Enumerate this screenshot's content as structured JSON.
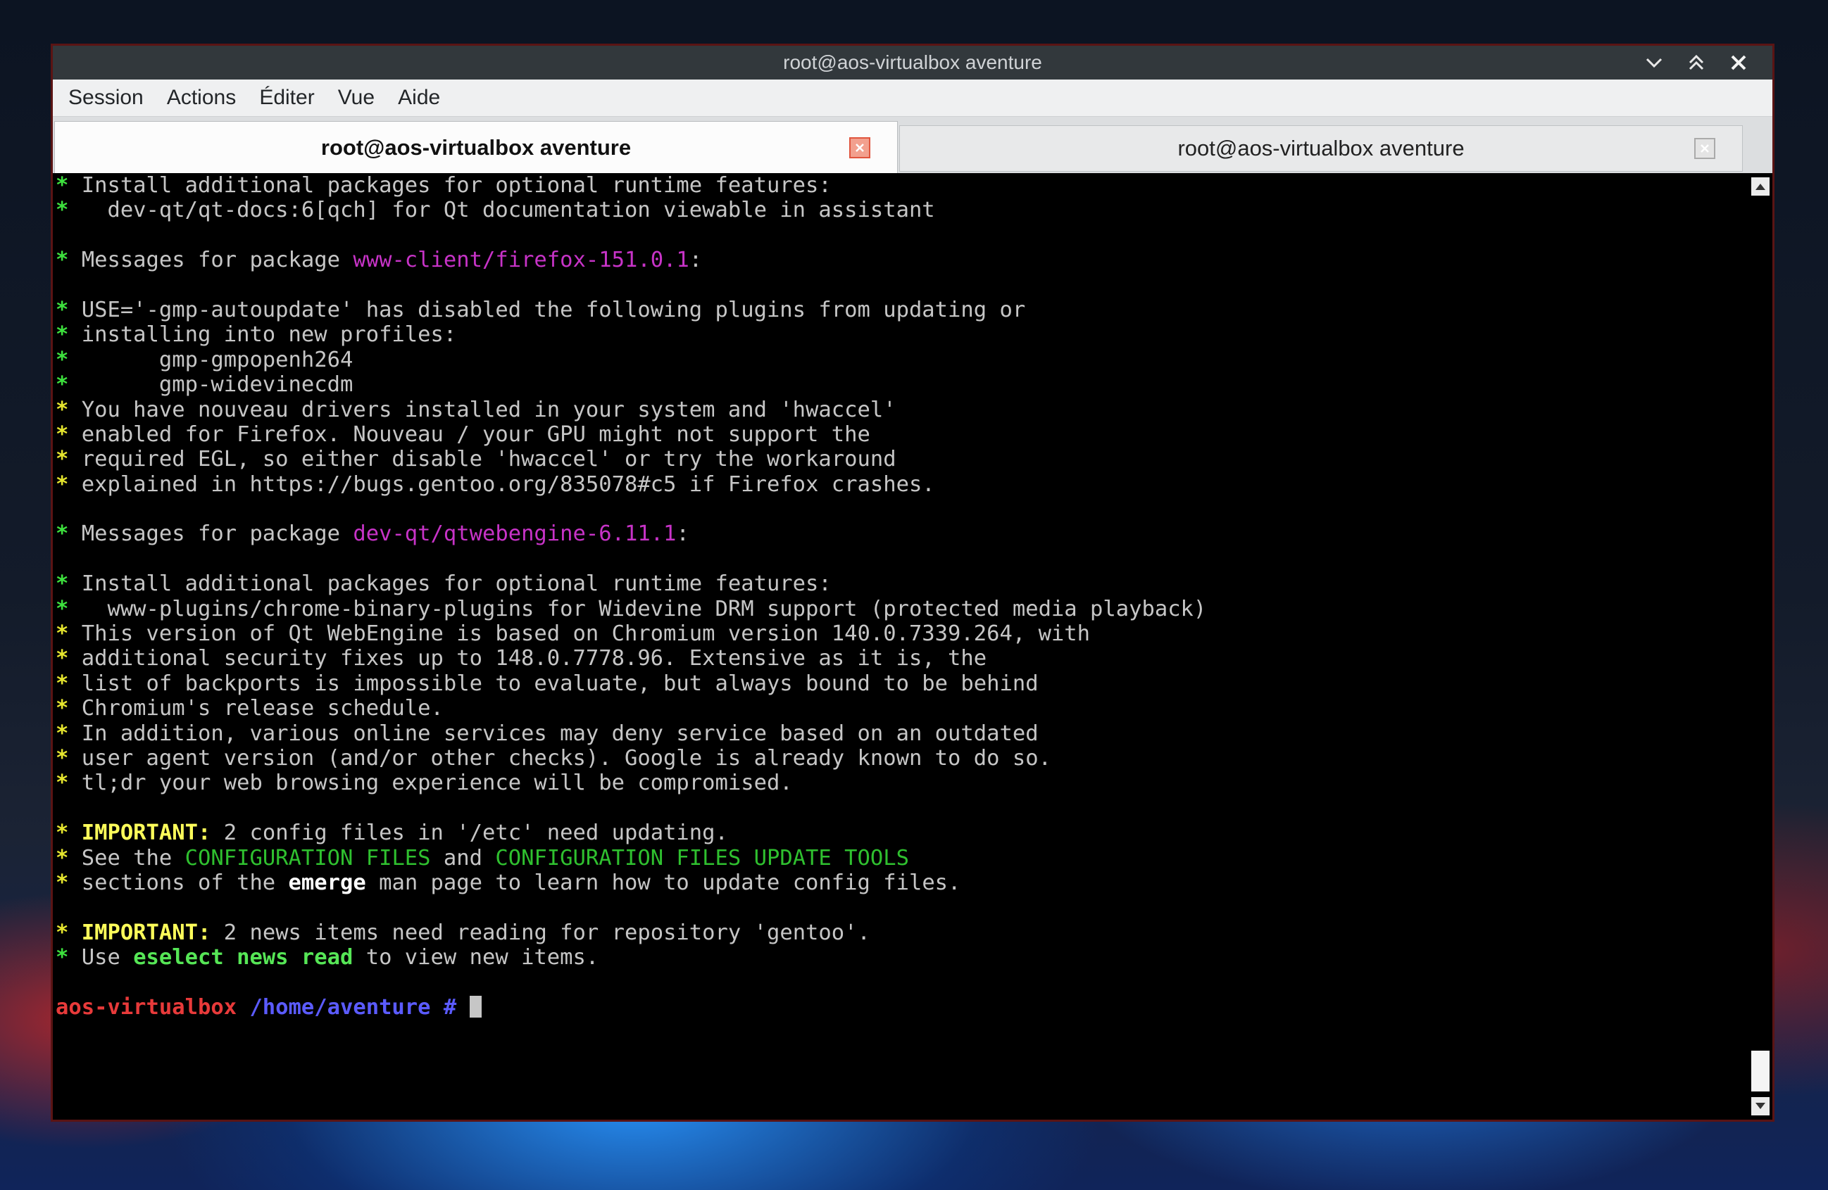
{
  "window": {
    "title": "root@aos-virtualbox aventure"
  },
  "menubar": {
    "items": [
      {
        "label": "Session"
      },
      {
        "label": "Actions"
      },
      {
        "label": "Éditer"
      },
      {
        "label": "Vue"
      },
      {
        "label": "Aide"
      }
    ]
  },
  "tabs": [
    {
      "label": "root@aos-virtualbox aventure",
      "active": true
    },
    {
      "label": "root@aos-virtualbox aventure",
      "active": false
    }
  ],
  "terminal": {
    "lines": [
      {
        "segments": [
          {
            "t": "* ",
            "c": "star"
          },
          {
            "t": "Install additional packages for optional runtime features:"
          }
        ]
      },
      {
        "segments": [
          {
            "t": "* ",
            "c": "star"
          },
          {
            "t": "  dev-qt/qt-docs:6[qch] for Qt documentation viewable in assistant"
          }
        ]
      },
      {
        "segments": []
      },
      {
        "segments": [
          {
            "t": "* ",
            "c": "star"
          },
          {
            "t": "Messages for package "
          },
          {
            "t": "www-client/firefox-151.0.1",
            "c": "pkg"
          },
          {
            "t": ":"
          }
        ]
      },
      {
        "segments": []
      },
      {
        "segments": [
          {
            "t": "* ",
            "c": "star"
          },
          {
            "t": "USE='-gmp-autoupdate' has disabled the following plugins from updating or"
          }
        ]
      },
      {
        "segments": [
          {
            "t": "* ",
            "c": "star"
          },
          {
            "t": "installing into new profiles:"
          }
        ]
      },
      {
        "segments": [
          {
            "t": "* ",
            "c": "star"
          },
          {
            "t": "      gmp-gmpopenh264"
          }
        ]
      },
      {
        "segments": [
          {
            "t": "* ",
            "c": "star"
          },
          {
            "t": "      gmp-widevinecdm"
          }
        ]
      },
      {
        "segments": [
          {
            "t": "* ",
            "c": "star-y"
          },
          {
            "t": "You have nouveau drivers installed in your system and 'hwaccel'"
          }
        ]
      },
      {
        "segments": [
          {
            "t": "* ",
            "c": "star-y"
          },
          {
            "t": "enabled for Firefox. Nouveau / your GPU might not support the"
          }
        ]
      },
      {
        "segments": [
          {
            "t": "* ",
            "c": "star-y"
          },
          {
            "t": "required EGL, so either disable 'hwaccel' or try the workaround"
          }
        ]
      },
      {
        "segments": [
          {
            "t": "* ",
            "c": "star-y"
          },
          {
            "t": "explained in https://bugs.gentoo.org/835078#c5 if Firefox crashes."
          }
        ]
      },
      {
        "segments": []
      },
      {
        "segments": [
          {
            "t": "* ",
            "c": "star"
          },
          {
            "t": "Messages for package "
          },
          {
            "t": "dev-qt/qtwebengine-6.11.1",
            "c": "pkg"
          },
          {
            "t": ":"
          }
        ]
      },
      {
        "segments": []
      },
      {
        "segments": [
          {
            "t": "* ",
            "c": "star"
          },
          {
            "t": "Install additional packages for optional runtime features:"
          }
        ]
      },
      {
        "segments": [
          {
            "t": "* ",
            "c": "star"
          },
          {
            "t": "  www-plugins/chrome-binary-plugins for Widevine DRM support (protected media playback)"
          }
        ]
      },
      {
        "segments": [
          {
            "t": "* ",
            "c": "star-y"
          },
          {
            "t": "This version of Qt WebEngine is based on Chromium version 140.0.7339.264, with"
          }
        ]
      },
      {
        "segments": [
          {
            "t": "* ",
            "c": "star-y"
          },
          {
            "t": "additional security fixes up to 148.0.7778.96. Extensive as it is, the"
          }
        ]
      },
      {
        "segments": [
          {
            "t": "* ",
            "c": "star-y"
          },
          {
            "t": "list of backports is impossible to evaluate, but always bound to be behind"
          }
        ]
      },
      {
        "segments": [
          {
            "t": "* ",
            "c": "star-y"
          },
          {
            "t": "Chromium's release schedule."
          }
        ]
      },
      {
        "segments": [
          {
            "t": "* ",
            "c": "star-y"
          },
          {
            "t": "In addition, various online services may deny service based on an outdated"
          }
        ]
      },
      {
        "segments": [
          {
            "t": "* ",
            "c": "star-y"
          },
          {
            "t": "user agent version (and/or other checks). Google is already known to do so."
          }
        ]
      },
      {
        "segments": [
          {
            "t": "* ",
            "c": "star-y"
          },
          {
            "t": "tl;dr your web browsing experience will be compromised."
          }
        ]
      },
      {
        "segments": []
      },
      {
        "segments": [
          {
            "t": "* ",
            "c": "star-y"
          },
          {
            "t": "IMPORTANT:",
            "c": "imp"
          },
          {
            "t": " 2 config files in '/etc' need updating."
          }
        ]
      },
      {
        "segments": [
          {
            "t": "* ",
            "c": "star-y"
          },
          {
            "t": "See the "
          },
          {
            "t": "CONFIGURATION FILES",
            "c": "grn"
          },
          {
            "t": " and "
          },
          {
            "t": "CONFIGURATION FILES UPDATE TOOLS",
            "c": "grn"
          }
        ]
      },
      {
        "segments": [
          {
            "t": "* ",
            "c": "star-y"
          },
          {
            "t": "sections of the "
          },
          {
            "t": "emerge",
            "c": "bold-w"
          },
          {
            "t": " man page to learn how to update config files."
          }
        ]
      },
      {
        "segments": []
      },
      {
        "segments": [
          {
            "t": "* ",
            "c": "star-y"
          },
          {
            "t": "IMPORTANT:",
            "c": "imp"
          },
          {
            "t": " 2 news items need reading for repository 'gentoo'."
          }
        ]
      },
      {
        "segments": [
          {
            "t": "* ",
            "c": "star"
          },
          {
            "t": "Use "
          },
          {
            "t": "eselect news read",
            "c": "bold-g"
          },
          {
            "t": " to view new items."
          }
        ]
      },
      {
        "segments": []
      }
    ],
    "prompt": {
      "host": "aos-virtualbox",
      "path": " /home/aventure",
      "symbol": " # "
    }
  },
  "colors": {
    "window_border": "#5a1414",
    "titlebar_bg": "#32383c",
    "menubar_bg": "#eff0f1",
    "terminal_bg": "#000000",
    "package_magenta": "#c733c7",
    "prompt_red": "#e83a3a",
    "prompt_blue": "#5b5bff"
  }
}
